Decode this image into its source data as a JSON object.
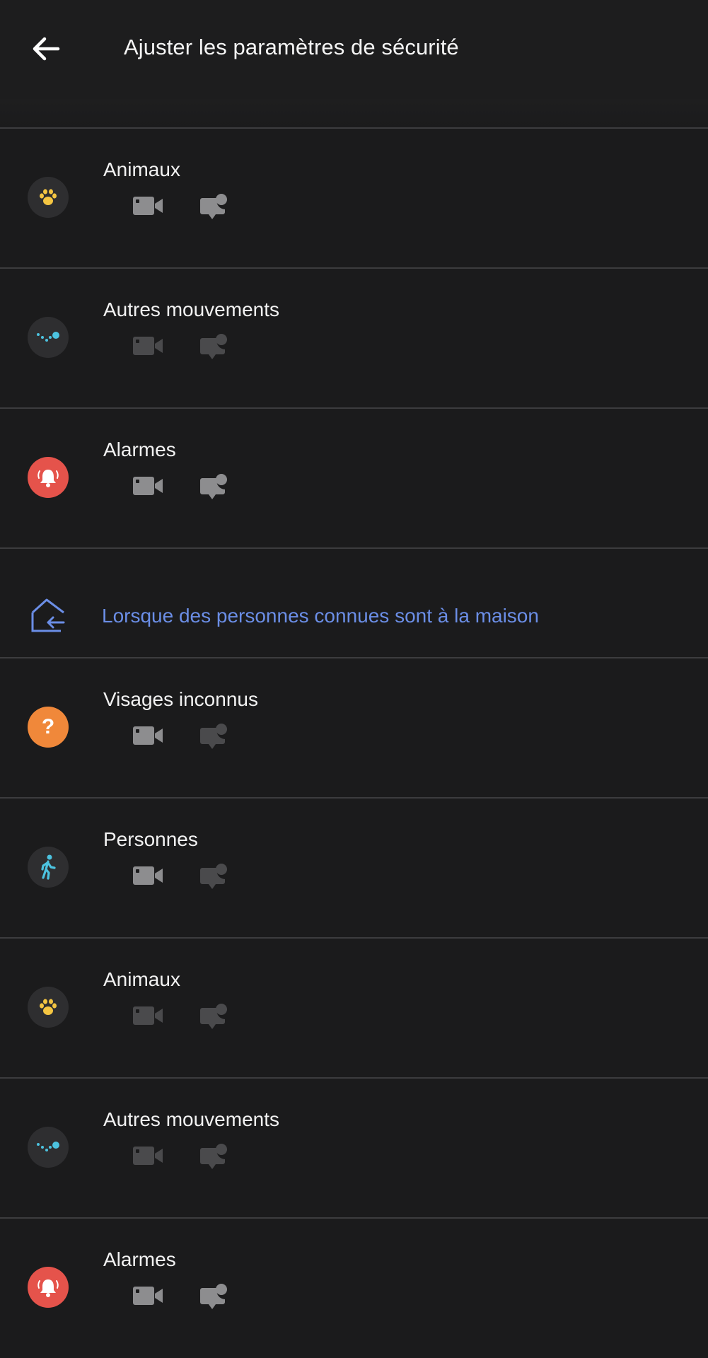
{
  "header": {
    "title": "Ajuster les paramètres de sécurité"
  },
  "colors": {
    "background": "#1b1b1c",
    "divider": "#3c3c3e",
    "accent_blue": "#6b8ee6",
    "alarm_red": "#e5534b",
    "unknown_orange": "#f0883a",
    "pet_yellow": "#f4c542",
    "motion_cyan": "#4cc3e0",
    "icon_enabled": "#8d8d8f",
    "icon_disabled": "#4a4a4c"
  },
  "rows_group1": [
    {
      "label": "Animaux",
      "icon": "paw-icon",
      "record": true,
      "notify": true
    },
    {
      "label": "Autres mouvements",
      "icon": "motion-dots-icon",
      "record": false,
      "notify": false
    },
    {
      "label": "Alarmes",
      "icon": "alarm-bell-icon",
      "record": true,
      "notify": true
    }
  ],
  "section": {
    "icon": "home-arrival-icon",
    "label": "Lorsque des personnes connues sont à la maison"
  },
  "rows_group2": [
    {
      "label": "Visages inconnus",
      "icon": "unknown-face-icon",
      "record": true,
      "notify": false
    },
    {
      "label": "Personnes",
      "icon": "walking-person-icon",
      "record": true,
      "notify": false
    },
    {
      "label": "Animaux",
      "icon": "paw-icon",
      "record": false,
      "notify": false
    },
    {
      "label": "Autres mouvements",
      "icon": "motion-dots-icon",
      "record": false,
      "notify": false
    },
    {
      "label": "Alarmes",
      "icon": "alarm-bell-icon",
      "record": true,
      "notify": true
    }
  ]
}
